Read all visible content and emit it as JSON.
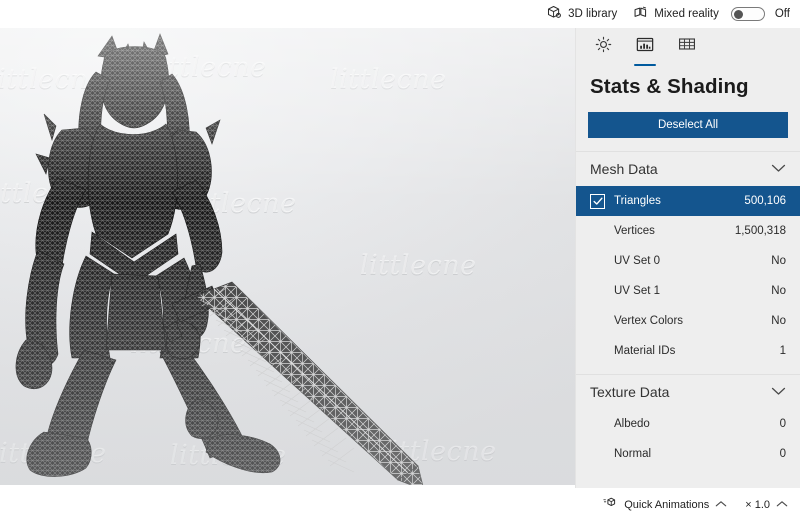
{
  "topbar": {
    "library_label": "3D library",
    "library_icon": "cube-3d-icon",
    "mixed_reality_label": "Mixed reality",
    "mixed_reality_icon": "mixed-reality-icon",
    "toggle_state_label": "Off",
    "toggle_on": false
  },
  "panel": {
    "tabs": [
      {
        "icon": "sun-lighting-icon",
        "name": "lighting",
        "active": false
      },
      {
        "icon": "stats-chart-icon",
        "name": "stats-shading",
        "active": true
      },
      {
        "icon": "grid-icon",
        "name": "grid",
        "active": false
      }
    ],
    "title": "Stats & Shading",
    "deselect_label": "Deselect All",
    "accent_color": "#14558e",
    "sections": [
      {
        "name": "mesh-data",
        "title": "Mesh Data",
        "expanded": true,
        "rows": [
          {
            "label": "Triangles",
            "value": "500,106",
            "selected": true,
            "checkbox": true
          },
          {
            "label": "Vertices",
            "value": "1,500,318",
            "selected": false,
            "checkbox": false
          },
          {
            "label": "UV Set 0",
            "value": "No",
            "selected": false,
            "checkbox": false
          },
          {
            "label": "UV Set 1",
            "value": "No",
            "selected": false,
            "checkbox": false
          },
          {
            "label": "Vertex Colors",
            "value": "No",
            "selected": false,
            "checkbox": false
          },
          {
            "label": "Material IDs",
            "value": "1",
            "selected": false,
            "checkbox": false
          }
        ]
      },
      {
        "name": "texture-data",
        "title": "Texture Data",
        "expanded": true,
        "rows": [
          {
            "label": "Albedo",
            "value": "0",
            "selected": false,
            "checkbox": false
          },
          {
            "label": "Normal",
            "value": "0",
            "selected": false,
            "checkbox": false
          }
        ]
      }
    ]
  },
  "statusbar": {
    "quick_animations_label": "Quick Animations",
    "quick_animations_icon": "animation-cube-icon",
    "speed_label": "× 1.0"
  },
  "viewport": {
    "watermark_text": "littlecne",
    "background_top": "#f2f3f4",
    "background_bottom": "#dedfe1",
    "model_name": "wireframe-warrior-with-sword"
  }
}
